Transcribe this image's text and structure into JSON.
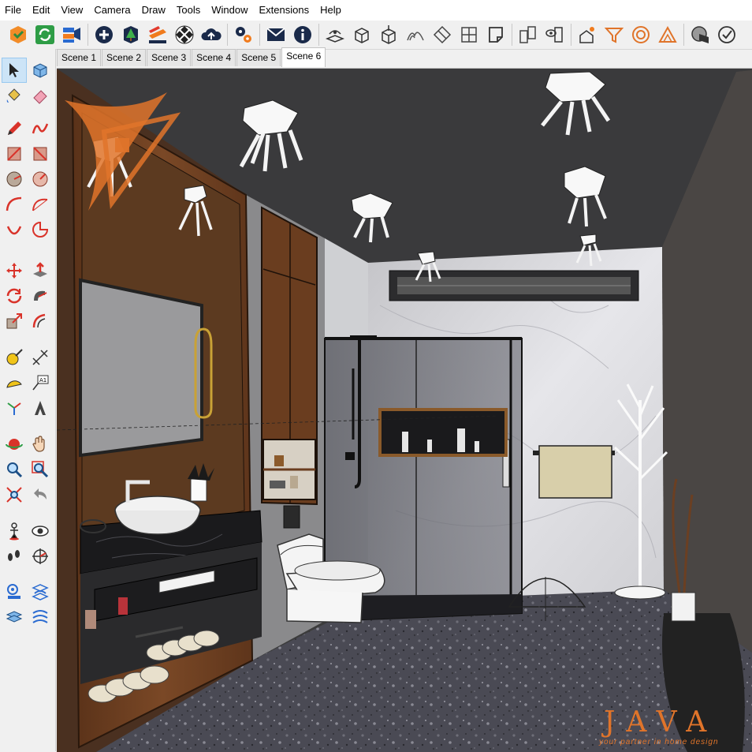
{
  "menu": [
    "File",
    "Edit",
    "View",
    "Camera",
    "Draw",
    "Tools",
    "Window",
    "Extensions",
    "Help"
  ],
  "scenes": {
    "tabs": [
      "Scene 1",
      "Scene 2",
      "Scene 3",
      "Scene 4",
      "Scene 5",
      "Scene 6"
    ],
    "active": "Scene 6"
  },
  "toolbar_icons": [
    "warehouse-icon",
    "sync-icon",
    "camera-toolbar-icon",
    "add-circle-icon",
    "tree-icon",
    "layers-orange-icon",
    "checker-sphere-icon",
    "cloud-upload-icon",
    "gears-icon",
    "mail-icon",
    "info-icon",
    "sandbox-icon",
    "box-icon",
    "box-push-icon",
    "hills-icon",
    "diamond-wrap-icon",
    "tile-icon",
    "page-curl-icon",
    "rect-pair-icon",
    "eye-door-icon",
    "house-sun-icon",
    "funnel-icon",
    "target-circle-icon",
    "triangle-ruler-icon",
    "sphere-section-icon",
    "check-badge-icon"
  ],
  "left_tools": [
    "select-icon",
    "component-icon",
    "paint-bucket-icon",
    "eraser-icon",
    "pencil-icon",
    "freehand-icon",
    "rectangle-icon",
    "rotated-rectangle-icon",
    "circle-icon",
    "polygon-icon",
    "arc-icon",
    "two-point-arc-icon",
    "three-point-arc-icon",
    "pie-icon",
    "move-icon",
    "push-pull-icon",
    "rotate-icon",
    "follow-me-icon",
    "scale-icon",
    "offset-icon",
    "tape-measure-icon",
    "dimension-icon",
    "protractor-icon",
    "text-icon",
    "axes-icon",
    "3d-text-icon",
    "orbit-icon",
    "pan-icon",
    "zoom-icon",
    "zoom-window-icon",
    "zoom-extents-icon",
    "previous-view-icon",
    "position-camera-icon",
    "look-around-icon",
    "walk-icon",
    "section-plane-icon",
    "sandbox-from-contours-icon",
    "sandbox-from-scratch-icon",
    "stamp-icon",
    "smoove-icon"
  ],
  "watermark": {
    "brand": "JAVA",
    "tagline": "your partner in home design",
    "color": "#e0742a"
  },
  "colors": {
    "ceiling": "#3a3a3a",
    "wood": "#6b3f22",
    "marble": "#d8d8dc",
    "floor": "#4a4a52",
    "accent": "#e0742a"
  }
}
